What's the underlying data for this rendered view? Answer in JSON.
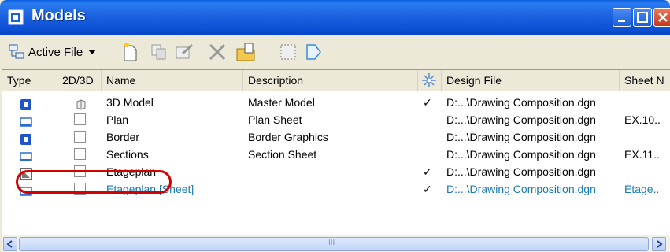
{
  "window": {
    "title": "Models",
    "colors": {
      "titlebar": "#0b4fd4",
      "highlight_ring": "#d60000",
      "sheet_row_text": "#1a7ab0"
    }
  },
  "toolbar": {
    "active_file_label": "Active File",
    "icons": [
      "models-icon",
      "dropdown-icon",
      "new-model-icon",
      "copy-model-icon",
      "properties-icon",
      "delete-icon",
      "import-icon",
      "select-icon",
      "sheet-icon"
    ]
  },
  "columns": {
    "type": "Type",
    "dim": "2D/3D",
    "name": "Name",
    "description": "Description",
    "design_file": "Design File",
    "sheet": "Sheet N"
  },
  "rows": [
    {
      "type_icon": "3d-model-icon",
      "dim_icon": "3d-cube-icon",
      "name": "3D Model",
      "description": "Master Model",
      "check": "✓",
      "design_file": "D:...\\Drawing Composition.dgn",
      "sheet": ""
    },
    {
      "type_icon": "sheet-model-icon",
      "dim_icon": "2d-box-icon",
      "name": "Plan",
      "description": "Plan Sheet",
      "check": "",
      "design_file": "D:...\\Drawing Composition.dgn",
      "sheet": "EX.10.."
    },
    {
      "type_icon": "3d-model-icon",
      "dim_icon": "2d-box-icon",
      "name": "Border",
      "description": "Border Graphics",
      "check": "",
      "design_file": "D:...\\Drawing Composition.dgn",
      "sheet": ""
    },
    {
      "type_icon": "sheet-model-icon",
      "dim_icon": "2d-box-icon",
      "name": "Sections",
      "description": "Section Sheet",
      "check": "",
      "design_file": "D:...\\Drawing Composition.dgn",
      "sheet": "EX.11.."
    },
    {
      "type_icon": "drawing-model-icon",
      "dim_icon": "2d-box-icon",
      "name": "Etageplan",
      "description": "",
      "check": "✓",
      "design_file": "D:...\\Drawing Composition.dgn",
      "sheet": ""
    },
    {
      "type_icon": "sheet-model-icon",
      "dim_icon": "2d-box-icon",
      "name": "Etageplan [Sheet]",
      "description": "",
      "check": "✓",
      "design_file": "D:...\\Drawing Composition.dgn",
      "sheet": "Etage.."
    }
  ],
  "scrollbar": {
    "thumb_grip": "III"
  }
}
